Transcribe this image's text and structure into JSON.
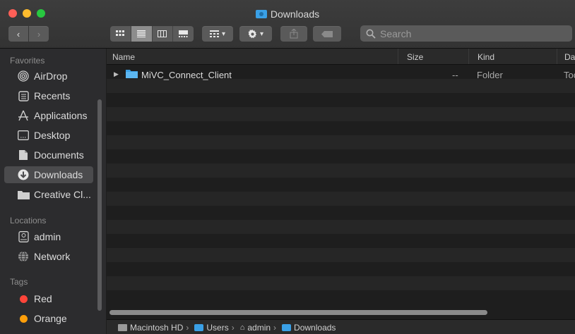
{
  "window": {
    "title": "Downloads"
  },
  "toolbar": {
    "back_glyph": "‹",
    "forward_glyph": "›",
    "group_glyph": "▾",
    "action_glyph": "▾",
    "search": {
      "placeholder": "Search",
      "value": ""
    }
  },
  "sidebar": {
    "favorites_header": "Favorites",
    "favorites": [
      {
        "label": "AirDrop",
        "icon": "airdrop-icon"
      },
      {
        "label": "Recents",
        "icon": "recents-icon"
      },
      {
        "label": "Applications",
        "icon": "applications-icon"
      },
      {
        "label": "Desktop",
        "icon": "desktop-icon"
      },
      {
        "label": "Documents",
        "icon": "documents-icon"
      },
      {
        "label": "Downloads",
        "icon": "downloads-icon",
        "selected": true
      },
      {
        "label": "Creative Cl...",
        "icon": "folder-icon"
      }
    ],
    "locations_header": "Locations",
    "locations": [
      {
        "label": "admin",
        "icon": "drive-icon"
      },
      {
        "label": "Network",
        "icon": "network-icon"
      }
    ],
    "tags_header": "Tags",
    "tags": [
      {
        "label": "Red",
        "color": "#ff453a"
      },
      {
        "label": "Orange",
        "color": "#ff9f0a"
      }
    ]
  },
  "list": {
    "columns": {
      "name": "Name",
      "size": "Size",
      "kind": "Kind",
      "date": "Da"
    },
    "files": [
      {
        "name": "MiVC_Connect_Client",
        "size": "--",
        "kind": "Folder",
        "date": "Toc"
      }
    ]
  },
  "pathbar": {
    "crumbs": [
      "Macintosh HD",
      "Users",
      "admin",
      "Downloads"
    ],
    "separator": "›"
  },
  "colors": {
    "accent": "#3aa0e6",
    "background": "#1e1e1e",
    "sidebar": "#2c2c2e"
  }
}
